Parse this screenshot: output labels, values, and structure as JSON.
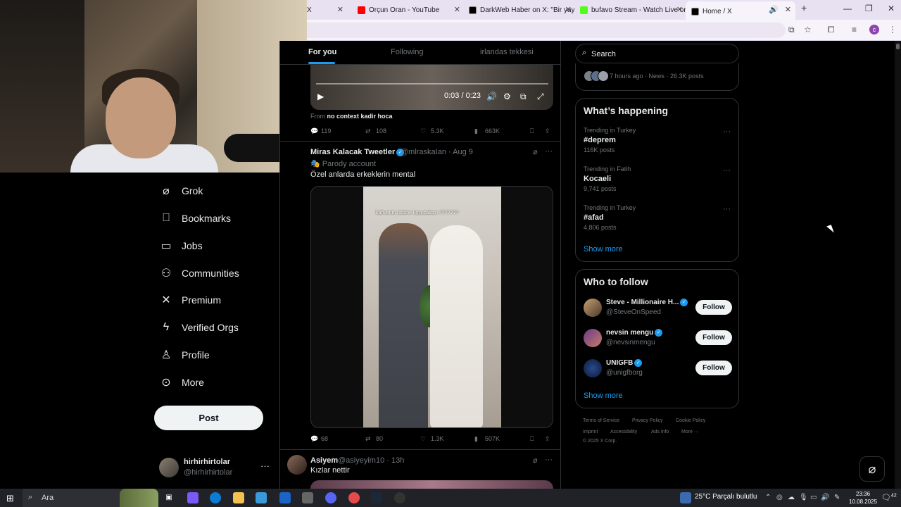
{
  "browser": {
    "tabs": [
      {
        "title": "X",
        "favicon_color": "#333333"
      },
      {
        "title": "Orçun Oran - YouTube",
        "favicon_color": "#ff0000"
      },
      {
        "title": "DarkWeb Haber on X: \"Bir yayı",
        "favicon_color": "#000000"
      },
      {
        "title": "bufavo Stream - Watch Live on",
        "favicon_color": "#53fc18"
      },
      {
        "title": "Home / X",
        "favicon_color": "#000000"
      }
    ],
    "new_tab": "+",
    "profile_initial": "c"
  },
  "nav": {
    "items": [
      {
        "label": "Grok",
        "icon": "grok-icon"
      },
      {
        "label": "Bookmarks",
        "icon": "bookmark-icon"
      },
      {
        "label": "Jobs",
        "icon": "briefcase-icon"
      },
      {
        "label": "Communities",
        "icon": "people-icon"
      },
      {
        "label": "Premium",
        "icon": "x-logo-icon"
      },
      {
        "label": "Verified Orgs",
        "icon": "lightning-icon"
      },
      {
        "label": "Profile",
        "icon": "person-icon"
      },
      {
        "label": "More",
        "icon": "more-circle-icon"
      }
    ],
    "post_label": "Post",
    "account": {
      "name": "hirhirhirtolar",
      "handle": "@hirhirhirtolar"
    }
  },
  "timeline": {
    "tabs": [
      "For you",
      "Following",
      "irlandas tekkesi"
    ],
    "video1": {
      "time": "0:03 / 0:23"
    },
    "from_label": "From",
    "from_source": "no context kadir hoca",
    "tweet1_actions": {
      "replies": "119",
      "retweets": "108",
      "likes": "5.3K",
      "views": "663K"
    },
    "tweet2": {
      "name": "Miras Kalacak Tweetler",
      "handle": "@mlraskaIan",
      "time": "· Aug 9",
      "label": "Parody account",
      "text": "Özel anlarda erkeklerin mental",
      "media_caption": "kahvenin üstüne koyucaksın ???????",
      "actions": {
        "replies": "68",
        "retweets": "80",
        "likes": "1.3K",
        "views": "507K"
      }
    },
    "tweet3": {
      "name": "Asiyem",
      "handle": "@asiyeyim10",
      "time": "· 13h",
      "text": "Kızlar nettir"
    }
  },
  "right": {
    "search_placeholder": "Search",
    "news_meta": "7 hours ago · News · 26.3K posts",
    "whats_happening": {
      "title": "What’s happening",
      "trends": [
        {
          "context": "Trending in Turkey",
          "tag": "#deprem",
          "count": "116K posts"
        },
        {
          "context": "Trending in Fatih",
          "tag": "Kocaeli",
          "count": "9,741 posts"
        },
        {
          "context": "Trending in Turkey",
          "tag": "#afad",
          "count": "4,806 posts"
        }
      ],
      "show_more": "Show more"
    },
    "who_to_follow": {
      "title": "Who to follow",
      "accounts": [
        {
          "name": "Steve - Millionaire H...",
          "handle": "@SteveOnSpeed",
          "button": "Follow"
        },
        {
          "name": "nevsin mengu",
          "handle": "@nevsinmengu",
          "button": "Follow"
        },
        {
          "name": "UNIGFB",
          "handle": "@unigfborg",
          "button": "Follow"
        }
      ],
      "show_more": "Show more"
    },
    "footer": {
      "line1": [
        "Terms of Service",
        "Privacy Policy",
        "Cookie Policy"
      ],
      "line2": [
        "Imprint",
        "Accessibility",
        "Ads info",
        "More ···"
      ],
      "copyright": "© 2025 X Corp."
    }
  },
  "taskbar": {
    "search_text": "Ara",
    "weather": "25°C  Parçalı bulutlu",
    "time": "23:36",
    "date": "10.08.2025",
    "notif_count": "42"
  }
}
